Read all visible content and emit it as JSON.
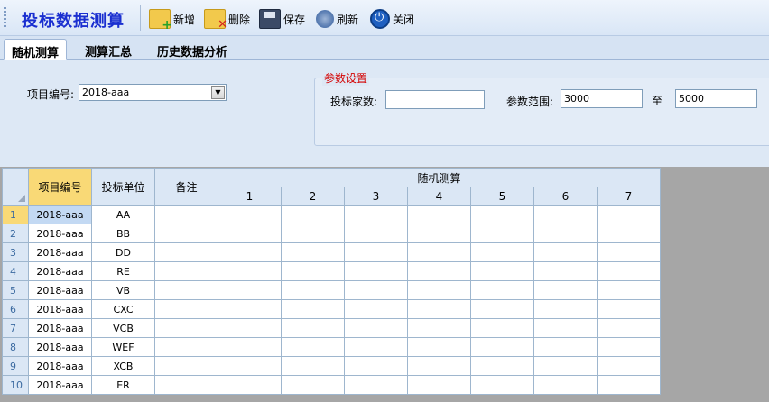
{
  "app": {
    "title": "投标数据测算"
  },
  "toolbar": {
    "new_label": "新增",
    "delete_label": "删除",
    "save_label": "保存",
    "refresh_label": "刷新",
    "close_label": "关闭"
  },
  "tabs": [
    {
      "label": "随机测算",
      "active": true
    },
    {
      "label": "测算汇总",
      "active": false
    },
    {
      "label": "历史数据分析",
      "active": false
    }
  ],
  "form": {
    "project_label": "项目编号:",
    "project_value": "2018-aaa",
    "group_title": "参数设置",
    "bidders_label": "投标家数:",
    "bidders_value": "",
    "range_label": "参数范围:",
    "range_from": "3000",
    "range_to_label": "至",
    "range_to": "5000"
  },
  "grid": {
    "headers": {
      "project": "项目编号",
      "unit": "投标单位",
      "remark": "备注",
      "random": "随机测算"
    },
    "sub_headers": [
      "1",
      "2",
      "3",
      "4",
      "5",
      "6",
      "7"
    ],
    "rows": [
      {
        "num": "1",
        "project": "2018-aaa",
        "unit": "AA"
      },
      {
        "num": "2",
        "project": "2018-aaa",
        "unit": "BB"
      },
      {
        "num": "3",
        "project": "2018-aaa",
        "unit": "DD"
      },
      {
        "num": "4",
        "project": "2018-aaa",
        "unit": "RE"
      },
      {
        "num": "5",
        "project": "2018-aaa",
        "unit": "VB"
      },
      {
        "num": "6",
        "project": "2018-aaa",
        "unit": "CXC"
      },
      {
        "num": "7",
        "project": "2018-aaa",
        "unit": "VCB"
      },
      {
        "num": "8",
        "project": "2018-aaa",
        "unit": "WEF"
      },
      {
        "num": "9",
        "project": "2018-aaa",
        "unit": "XCB"
      },
      {
        "num": "10",
        "project": "2018-aaa",
        "unit": "ER"
      }
    ]
  }
}
